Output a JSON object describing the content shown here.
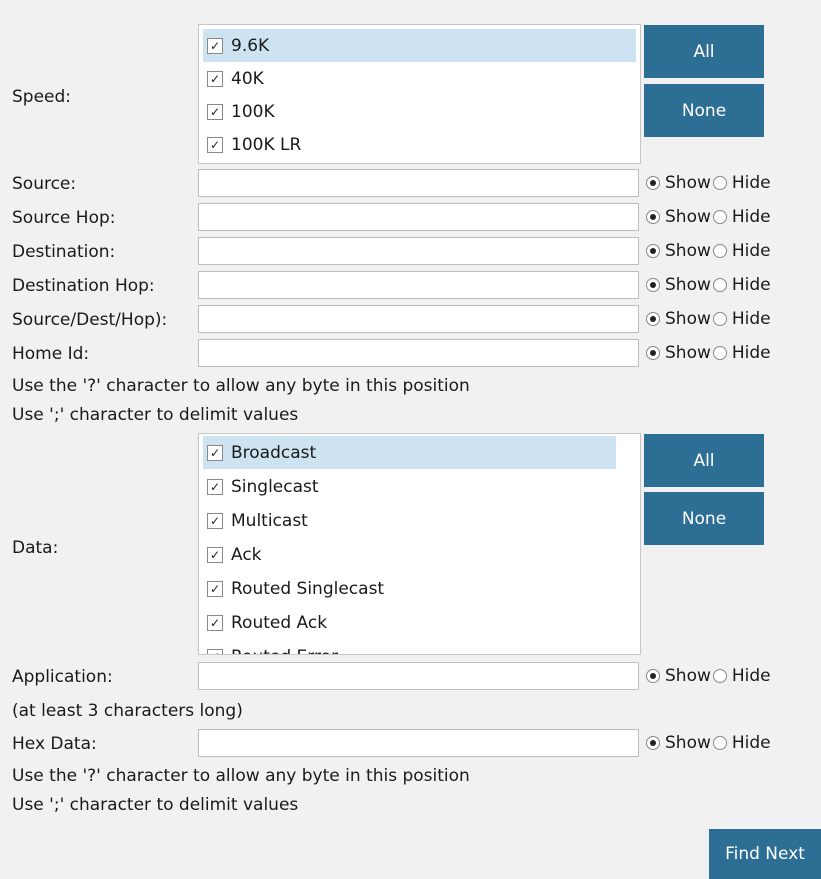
{
  "speed": {
    "label": "Speed:",
    "items": [
      {
        "label": "9.6K",
        "checked": true,
        "selected": true
      },
      {
        "label": "40K",
        "checked": true,
        "selected": false
      },
      {
        "label": "100K",
        "checked": true,
        "selected": false
      },
      {
        "label": "100K LR",
        "checked": true,
        "selected": false
      }
    ],
    "all_button": "All",
    "none_button": "None"
  },
  "filters": [
    {
      "label": "Source:",
      "value": "",
      "show": "Show",
      "hide": "Hide",
      "selected": "show"
    },
    {
      "label": "Source Hop:",
      "value": "",
      "show": "Show",
      "hide": "Hide",
      "selected": "show"
    },
    {
      "label": "Destination:",
      "value": "",
      "show": "Show",
      "hide": "Hide",
      "selected": "show"
    },
    {
      "label": "Destination Hop:",
      "value": "",
      "show": "Show",
      "hide": "Hide",
      "selected": "show"
    },
    {
      "label": "Source/Dest/Hop):",
      "value": "",
      "show": "Show",
      "hide": "Hide",
      "selected": "show"
    },
    {
      "label": "Home Id:",
      "value": "",
      "show": "Show",
      "hide": "Hide",
      "selected": "show"
    }
  ],
  "notes1": {
    "line1": "Use the '?' character to allow any byte in this position",
    "line2": "Use ';' character to delimit values"
  },
  "data": {
    "label": "Data:",
    "items": [
      {
        "label": "Broadcast",
        "checked": true,
        "selected": true
      },
      {
        "label": "Singlecast",
        "checked": true,
        "selected": false
      },
      {
        "label": "Multicast",
        "checked": true,
        "selected": false
      },
      {
        "label": "Ack",
        "checked": true,
        "selected": false
      },
      {
        "label": "Routed Singlecast",
        "checked": true,
        "selected": false
      },
      {
        "label": "Routed Ack",
        "checked": true,
        "selected": false
      },
      {
        "label": "Routed Error",
        "checked": true,
        "selected": false
      }
    ],
    "all_button": "All",
    "none_button": "None"
  },
  "application": {
    "label": "Application:",
    "value": "",
    "show": "Show",
    "hide": "Hide",
    "selected": "show",
    "hint": "(at least 3 characters long)"
  },
  "hexdata": {
    "label": "Hex Data:",
    "value": "",
    "show": "Show",
    "hide": "Hide",
    "selected": "show"
  },
  "notes2": {
    "line1": "Use the '?' character to allow any byte in this position",
    "line2": "Use ';' character to delimit values"
  },
  "find_next": "Find Next",
  "check_glyph": "✓"
}
